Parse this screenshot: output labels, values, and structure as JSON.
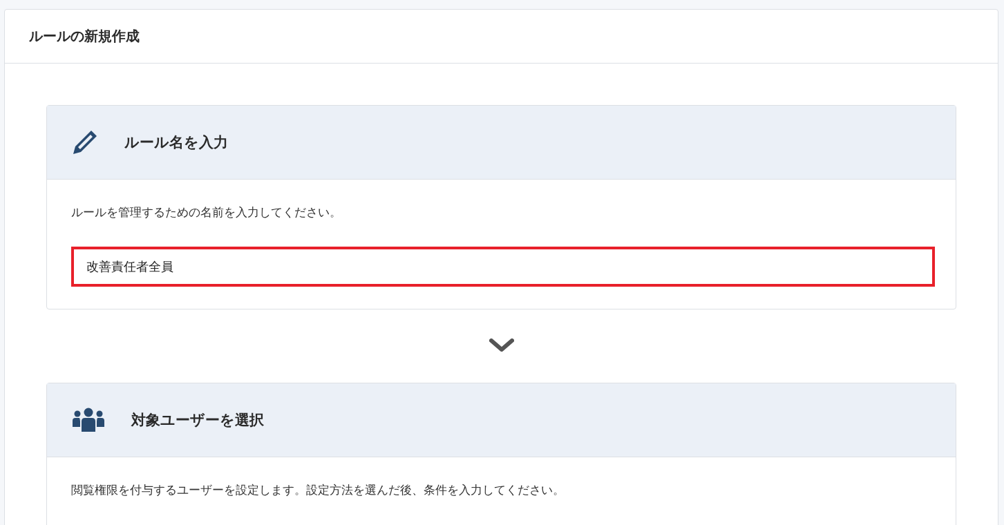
{
  "page": {
    "title": "ルールの新規作成"
  },
  "steps": [
    {
      "kind": "name",
      "title": "ルール名を入力",
      "description": "ルールを管理するための名前を入力してください。",
      "field": {
        "value": "改善責任者全員",
        "highlighted": true
      }
    },
    {
      "kind": "users",
      "title": "対象ユーザーを選択",
      "description": "閲覧権限を付与するユーザーを設定します。設定方法を選んだ後、条件を入力してください。"
    }
  ]
}
